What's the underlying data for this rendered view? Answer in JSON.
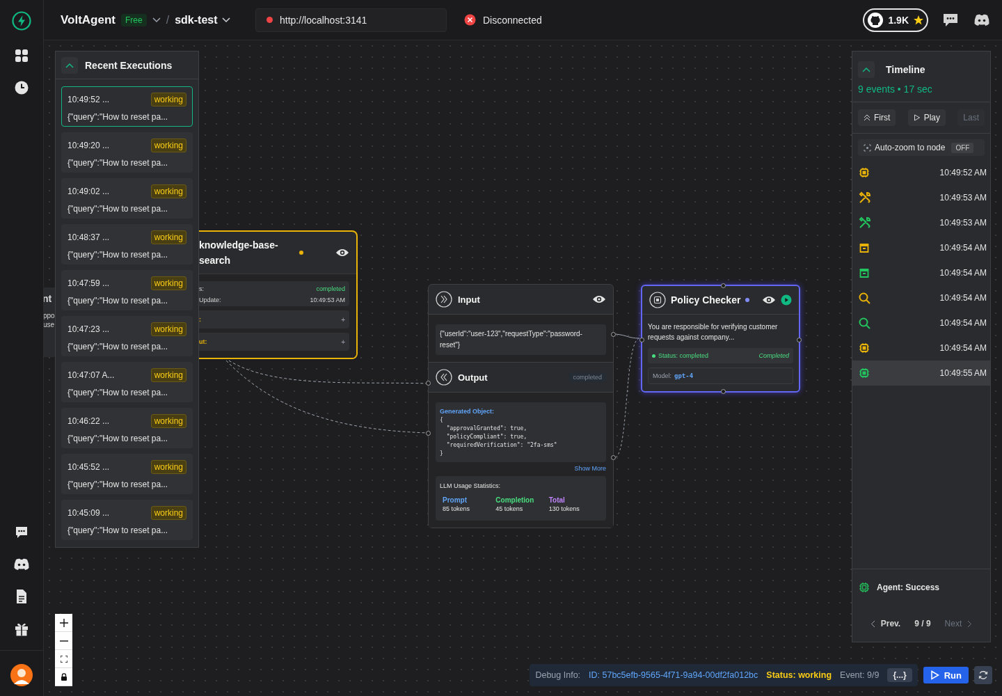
{
  "topbar": {
    "brand": "VoltAgent",
    "plan": "Free",
    "separator": "/",
    "project": "sdk-test",
    "url": "http://localhost:3141",
    "connection": {
      "label": "Disconnected",
      "connected": false
    },
    "github_stars": "1.9K"
  },
  "recent_executions": {
    "title": "Recent Executions",
    "expanded": true,
    "items": [
      {
        "time": "10:49:52 ...",
        "status": "working",
        "query": "{\"query\":\"How to reset pa...",
        "selected": true
      },
      {
        "time": "10:49:20 ...",
        "status": "working",
        "query": "{\"query\":\"How to reset pa...",
        "selected": false
      },
      {
        "time": "10:49:02 ...",
        "status": "working",
        "query": "{\"query\":\"How to reset pa...",
        "selected": false
      },
      {
        "time": "10:48:37 ...",
        "status": "working",
        "query": "{\"query\":\"How to reset pa...",
        "selected": false
      },
      {
        "time": "10:47:59 ...",
        "status": "working",
        "query": "{\"query\":\"How to reset pa...",
        "selected": false
      },
      {
        "time": "10:47:23 ...",
        "status": "working",
        "query": "{\"query\":\"How to reset pa...",
        "selected": false
      },
      {
        "time": "10:47:07 A...",
        "status": "working",
        "query": "{\"query\":\"How to reset pa...",
        "selected": false
      },
      {
        "time": "10:46:22 ...",
        "status": "working",
        "query": "{\"query\":\"How to reset pa...",
        "selected": false
      },
      {
        "time": "10:45:52 ...",
        "status": "working",
        "query": "{\"query\":\"How to reset pa...",
        "selected": false
      },
      {
        "time": "10:45:09 ...",
        "status": "working",
        "query": "{\"query\":\"How to reset pa...",
        "selected": false
      }
    ]
  },
  "hidden_node": {
    "title": "nt",
    "lines": [
      "ppo",
      "use"
    ]
  },
  "knowledge_node": {
    "title": "knowledge-base-search",
    "status_label": "s:",
    "status": "completed",
    "update_label": "Update:",
    "update": "10:49:53 AM",
    "sections": [
      {
        "label": ":",
        "toggle": "+"
      },
      {
        "label": "ut:",
        "toggle": "+"
      }
    ]
  },
  "flow_node": {
    "input": {
      "title": "Input",
      "value": "{\"userId\":\"user-123\",\"requestType\":\"password-reset\"}"
    },
    "output": {
      "title": "Output",
      "badge": "completed",
      "generated_label": "Generated Object:",
      "code": "{\n  \"approvalGranted\": true,\n  \"policyCompliant\": true,\n  \"requiredVerification\": \"2fa-sms\"\n}",
      "show_more": "Show More",
      "usage": {
        "title": "LLM Usage Statistics:",
        "stats": [
          {
            "label": "Prompt",
            "value": "85 tokens",
            "color": "#60a5fa"
          },
          {
            "label": "Completion",
            "value": "45 tokens",
            "color": "#4ade80"
          },
          {
            "label": "Total",
            "value": "130 tokens",
            "color": "#c084fc"
          }
        ]
      }
    }
  },
  "policy_node": {
    "title": "Policy Checker",
    "description": "You are responsible for verifying customer requests against company...",
    "status": "Status: completed",
    "status_badge": "Completed",
    "model_label": "Model:",
    "model": "gpt-4"
  },
  "timeline": {
    "title": "Timeline",
    "expanded": true,
    "summary": "9 events • 17 sec",
    "buttons": [
      {
        "kind": "first",
        "label": "First",
        "disabled": false
      },
      {
        "kind": "play",
        "label": "Play",
        "disabled": false
      },
      {
        "kind": "last",
        "label": "Last",
        "disabled": true
      }
    ],
    "auto_zoom": {
      "label": "Auto-zoom to node",
      "state": "OFF",
      "on": false
    },
    "events": [
      {
        "kind": "agent",
        "color": "#eab308",
        "time": "10:49:52 AM",
        "selected": false
      },
      {
        "kind": "tool",
        "color": "#eab308",
        "time": "10:49:53 AM",
        "selected": false
      },
      {
        "kind": "tool",
        "color": "#22c55e",
        "time": "10:49:53 AM",
        "selected": false
      },
      {
        "kind": "memory",
        "color": "#eab308",
        "time": "10:49:54 AM",
        "selected": false
      },
      {
        "kind": "memory",
        "color": "#22c55e",
        "time": "10:49:54 AM",
        "selected": false
      },
      {
        "kind": "retriever",
        "color": "#eab308",
        "time": "10:49:54 AM",
        "selected": false
      },
      {
        "kind": "retriever",
        "color": "#22c55e",
        "time": "10:49:54 AM",
        "selected": false
      },
      {
        "kind": "agent",
        "color": "#eab308",
        "time": "10:49:54 AM",
        "selected": false
      },
      {
        "kind": "agent",
        "color": "#22c55e",
        "time": "10:49:55 AM",
        "selected": true
      }
    ],
    "footer_status": "Agent: Success",
    "pager": {
      "prev": "Prev.",
      "position": "9 / 9",
      "next": "Next",
      "next_disabled": true
    }
  },
  "debug": {
    "label": "Debug Info:",
    "id": "ID: 57bc5efb-9565-4f71-9a94-00df2fa012bc",
    "status": "Status: working",
    "event": "Event: 9/9",
    "json_button": "{...}",
    "run": "Run"
  }
}
